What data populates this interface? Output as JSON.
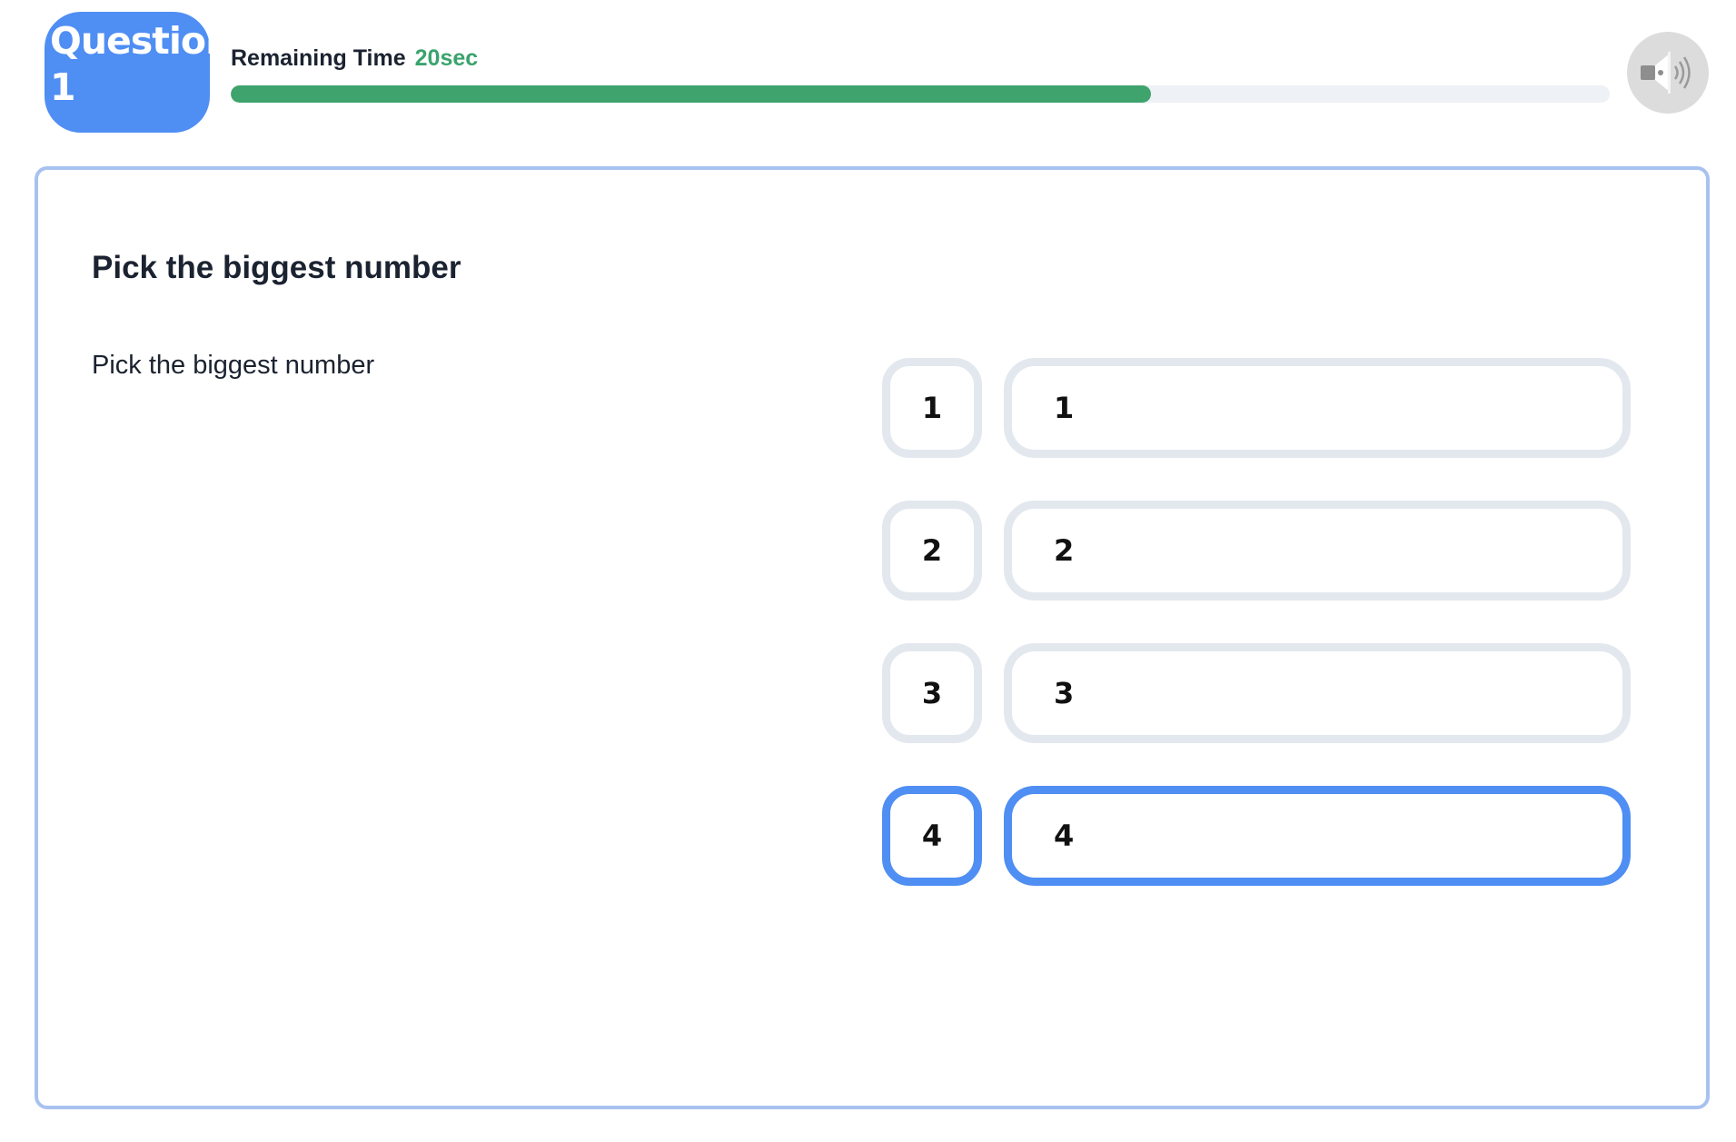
{
  "header": {
    "question_label": "Question",
    "question_number": "1",
    "timer_label": "Remaining Time",
    "timer_value": "20sec",
    "progress_fraction": 0.667,
    "sound_icon": "speaker-icon"
  },
  "question": {
    "title": "Pick the biggest number",
    "body": "Pick the biggest number"
  },
  "options": [
    {
      "key": "1",
      "answer": "1",
      "selected": false
    },
    {
      "key": "2",
      "answer": "2",
      "selected": false
    },
    {
      "key": "3",
      "answer": "3",
      "selected": false
    },
    {
      "key": "4",
      "answer": "4",
      "selected": true
    }
  ],
  "colors": {
    "accent": "#4f8ef3",
    "timer": "#3aa36d",
    "option_border": "#e3e8ef",
    "card_border": "#a8c2f0"
  }
}
